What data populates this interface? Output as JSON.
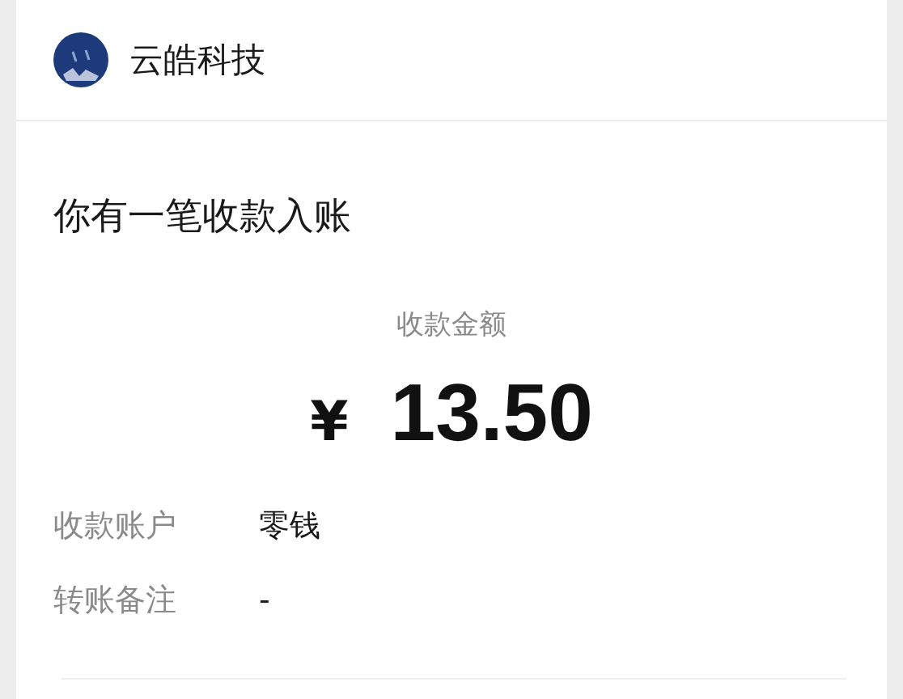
{
  "sender": {
    "name": "云皓科技"
  },
  "notice": {
    "title": "你有一笔收款入账",
    "amount_label": "收款金额",
    "currency": "¥",
    "amount": "13.50",
    "details": [
      {
        "label": "收款账户",
        "value": "零钱"
      },
      {
        "label": "转账备注",
        "value": "-"
      }
    ]
  }
}
